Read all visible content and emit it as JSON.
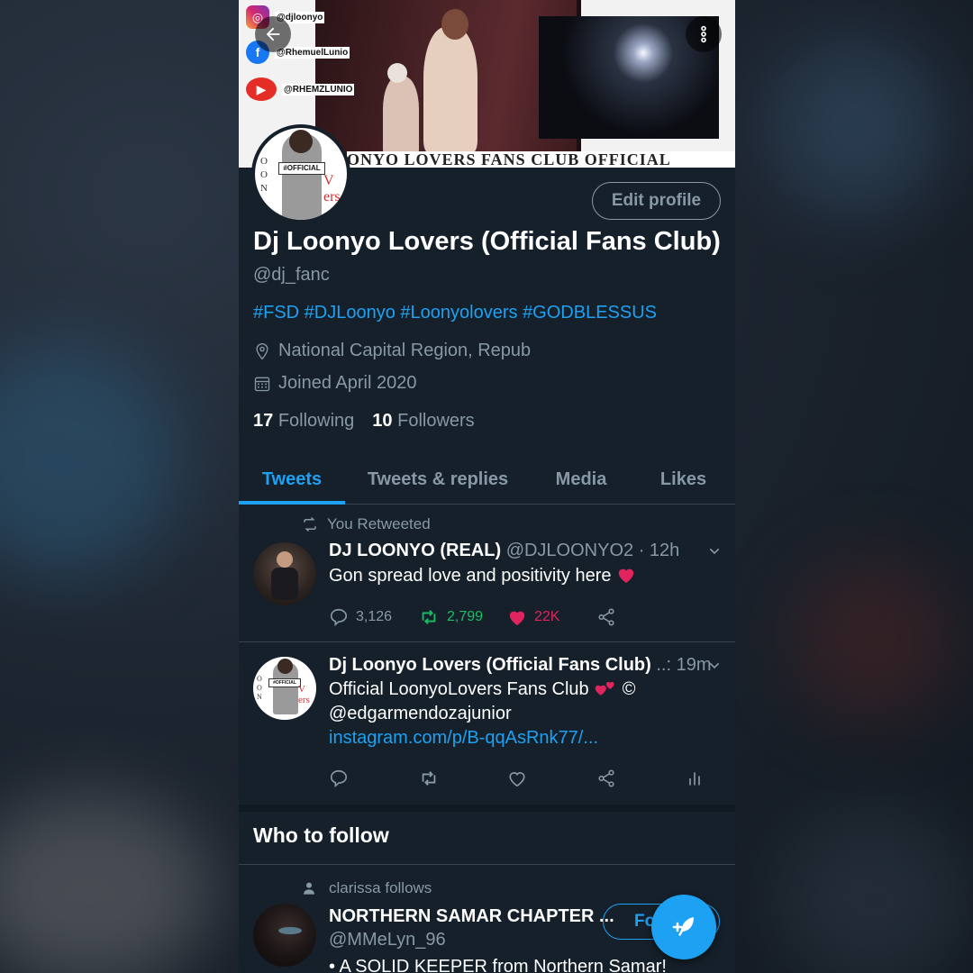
{
  "banner": {
    "instagram_handle": "@djloonyo",
    "facebook_handle": "@RhemuelLunio",
    "youtube_handle": "@RHEMZLUNIO",
    "strip_text": "ONYO LOVERS FANS CLUB OFFICIAL"
  },
  "profile": {
    "edit_label": "Edit profile",
    "name": "Dj Loonyo Lovers (Official Fans Club)",
    "handle": "@dj_fanc",
    "bio": "#FSD #DJLoonyo #Loonyolovers #GODBLESSUS",
    "location": "National Capital Region, Repub",
    "joined": "Joined April 2020",
    "following_count": "17",
    "following_label": "Following",
    "followers_count": "10",
    "followers_label": "Followers"
  },
  "tabs": [
    {
      "label": "Tweets"
    },
    {
      "label": "Tweets & replies"
    },
    {
      "label": "Media"
    },
    {
      "label": "Likes"
    }
  ],
  "tweets": [
    {
      "retweet_note": "You Retweeted",
      "author": "DJ LOONYO (REAL)",
      "handle_time": "@DJLOONYO2 · 12h",
      "text": "Gon spread love and positivity here",
      "replies": "3,126",
      "retweets": "2,799",
      "likes": "22K"
    },
    {
      "author": "Dj Loonyo Lovers (Official Fans Club)",
      "handle_time": "..: 19m",
      "text_line1": "Official LoonyoLovers Fans Club",
      "text_line2": "@edgarmendozajunior",
      "link": "instagram.com/p/B-qqAsRnk77/..."
    }
  ],
  "who_to_follow": {
    "title": "Who to follow",
    "social_context": "clarissa follows",
    "name": "NORTHERN SAMAR CHAPTER ...",
    "handle": "@MMeLyn_96",
    "bio": "• A SOLID KEEPER from Northern Samar!",
    "follow_label": "Fo"
  },
  "colors": {
    "accent": "#1da1f2",
    "background": "#15202b",
    "secondary_text": "#8899a6",
    "like_pink": "#e0245e",
    "retweet_green": "#17bf63"
  }
}
